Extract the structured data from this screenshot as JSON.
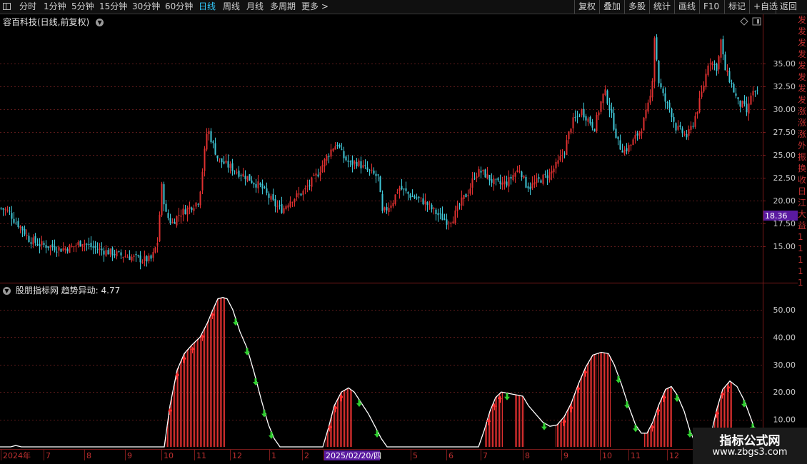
{
  "toolbar": {
    "left_items": [
      "分时",
      "1分钟",
      "5分钟",
      "15分钟",
      "30分钟",
      "60分钟",
      "日线",
      "周线",
      "月线",
      "多周期",
      "更多 >"
    ],
    "active_index": 6,
    "right_items": [
      "复权",
      "叠加",
      "多股",
      "统计",
      "画线",
      "F10",
      "标记",
      "+自选",
      "返回"
    ]
  },
  "stock_title": "容百科技(日线,前复权)",
  "indicator_title": "股朋指标网 趋势异动:",
  "indicator_value": "4.77",
  "price_axis_labels": [
    "35.00",
    "32.50",
    "30.00",
    "27.50",
    "25.00",
    "22.50",
    "20.00",
    "17.50",
    "15.00"
  ],
  "current_price": "18.36",
  "indicator_axis_labels": [
    "50.00",
    "40.00",
    "30.00",
    "20.00",
    "10.00"
  ],
  "date_axis_labels": [
    "2024年",
    "7",
    "8",
    "9",
    "10",
    "11",
    "12",
    "1",
    "2",
    "2025/02/20/四",
    "5",
    "6",
    "7",
    "8",
    "9",
    "10",
    "11",
    "12"
  ],
  "right_strip_chars": [
    "发",
    "发",
    "发",
    "发",
    "发",
    "发",
    "发",
    "发",
    "涨",
    "涨",
    "涨",
    "外",
    "振",
    "换",
    "收",
    "日",
    "江",
    "大",
    "益",
    "1",
    "1",
    "1",
    "1",
    "1"
  ],
  "watermark": {
    "title": "指标公式网",
    "url": "www.zbgs3.com"
  },
  "colors": {
    "bg": "#000000",
    "up": "#e03030",
    "down": "#40c8d8",
    "accent": "#33ccff",
    "grid": "#5a1a1a",
    "highlight": "#5a1aa0",
    "curve": "#ffffff",
    "down_arrow": "#30d030"
  },
  "chart_data": [
    {
      "type": "candlestick",
      "title": "容百科技(日线,前复权)",
      "ylim": [
        12,
        38
      ],
      "y_ticks": [
        15,
        17.5,
        20,
        22.5,
        25,
        27.5,
        30,
        32.5,
        35
      ],
      "last_price": 18.36,
      "anchors": [
        [
          0,
          19.2
        ],
        [
          12,
          18.8
        ],
        [
          20,
          17.8
        ],
        [
          30,
          17.0
        ],
        [
          40,
          15.8
        ],
        [
          55,
          15.2
        ],
        [
          70,
          15.0
        ],
        [
          85,
          14.7
        ],
        [
          100,
          14.9
        ],
        [
          115,
          15.5
        ],
        [
          125,
          15.0
        ],
        [
          140,
          14.6
        ],
        [
          155,
          14.3
        ],
        [
          170,
          14.0
        ],
        [
          185,
          13.8
        ],
        [
          200,
          13.5
        ],
        [
          212,
          13.6
        ],
        [
          220,
          15.5
        ],
        [
          226,
          21.5
        ],
        [
          232,
          18.5
        ],
        [
          240,
          17.5
        ],
        [
          250,
          18.5
        ],
        [
          260,
          19.0
        ],
        [
          270,
          19.5
        ],
        [
          278,
          20.0
        ],
        [
          284,
          24.0
        ],
        [
          290,
          28.0
        ],
        [
          296,
          26.5
        ],
        [
          305,
          24.5
        ],
        [
          315,
          24.0
        ],
        [
          325,
          23.5
        ],
        [
          335,
          23.0
        ],
        [
          345,
          22.6
        ],
        [
          355,
          22.0
        ],
        [
          365,
          21.5
        ],
        [
          375,
          20.5
        ],
        [
          385,
          19.5
        ],
        [
          395,
          19.0
        ],
        [
          405,
          20.0
        ],
        [
          415,
          20.5
        ],
        [
          425,
          21.0
        ],
        [
          435,
          22.0
        ],
        [
          445,
          23.0
        ],
        [
          455,
          24.5
        ],
        [
          465,
          25.8
        ],
        [
          472,
          26.2
        ],
        [
          480,
          24.8
        ],
        [
          490,
          24.0
        ],
        [
          500,
          24.2
        ],
        [
          510,
          23.5
        ],
        [
          520,
          23.0
        ],
        [
          530,
          22.5
        ],
        [
          534,
          18.5
        ],
        [
          542,
          19.2
        ],
        [
          550,
          20.0
        ],
        [
          558,
          21.5
        ],
        [
          566,
          21.0
        ],
        [
          575,
          20.5
        ],
        [
          585,
          20.2
        ],
        [
          595,
          19.8
        ],
        [
          605,
          19.0
        ],
        [
          615,
          18.3
        ],
        [
          625,
          17.8
        ],
        [
          633,
          18.0
        ],
        [
          640,
          19.0
        ],
        [
          648,
          20.2
        ],
        [
          656,
          21.0
        ],
        [
          664,
          22.8
        ],
        [
          672,
          23.2
        ],
        [
          680,
          22.8
        ],
        [
          690,
          22.0
        ],
        [
          700,
          21.8
        ],
        [
          710,
          22.0
        ],
        [
          720,
          23.0
        ],
        [
          728,
          23.5
        ],
        [
          735,
          21.8
        ],
        [
          742,
          21.5
        ],
        [
          750,
          22.0
        ],
        [
          760,
          22.5
        ],
        [
          770,
          23.0
        ],
        [
          780,
          24.0
        ],
        [
          790,
          25.5
        ],
        [
          800,
          28.5
        ],
        [
          808,
          29.2
        ],
        [
          814,
          29.8
        ],
        [
          822,
          29.0
        ],
        [
          832,
          28.0
        ],
        [
          840,
          30.5
        ],
        [
          846,
          32.0
        ],
        [
          852,
          30.5
        ],
        [
          858,
          28.5
        ],
        [
          866,
          26.0
        ],
        [
          874,
          25.5
        ],
        [
          882,
          26.0
        ],
        [
          890,
          27.0
        ],
        [
          898,
          28.0
        ],
        [
          906,
          30.0
        ],
        [
          912,
          32.0
        ],
        [
          916,
          38.0
        ],
        [
          922,
          33.0
        ],
        [
          930,
          31.0
        ],
        [
          938,
          30.0
        ],
        [
          946,
          28.0
        ],
        [
          954,
          27.5
        ],
        [
          962,
          27.0
        ],
        [
          970,
          28.5
        ],
        [
          978,
          30.5
        ],
        [
          986,
          33.0
        ],
        [
          992,
          35.5
        ],
        [
          998,
          35.0
        ],
        [
          1004,
          34.5
        ],
        [
          1009,
          37.5
        ],
        [
          1014,
          34.5
        ],
        [
          1020,
          33.5
        ],
        [
          1027,
          32.0
        ],
        [
          1034,
          30.5
        ],
        [
          1040,
          30.5
        ],
        [
          1046,
          29.5
        ],
        [
          1052,
          32.0
        ],
        [
          1058,
          31.5
        ],
        [
          1062,
          31.8
        ]
      ],
      "vol_seed": 7
    },
    {
      "type": "area",
      "title": "股朋指标网 趋势异动",
      "ylim": [
        0,
        55
      ],
      "y_ticks": [
        10,
        20,
        30,
        40,
        50
      ],
      "curve": [
        [
          0,
          0
        ],
        [
          15,
          0
        ],
        [
          22,
          0.5
        ],
        [
          30,
          0
        ],
        [
          200,
          0
        ],
        [
          230,
          0
        ],
        [
          238,
          15
        ],
        [
          248,
          28
        ],
        [
          258,
          34
        ],
        [
          268,
          37
        ],
        [
          280,
          40
        ],
        [
          290,
          45
        ],
        [
          298,
          50
        ],
        [
          305,
          54
        ],
        [
          312,
          54.5
        ],
        [
          318,
          54
        ],
        [
          326,
          50
        ],
        [
          336,
          42
        ],
        [
          346,
          36
        ],
        [
          356,
          27
        ],
        [
          366,
          17
        ],
        [
          376,
          8
        ],
        [
          384,
          3
        ],
        [
          392,
          0
        ],
        [
          452,
          0
        ],
        [
          460,
          7
        ],
        [
          468,
          15
        ],
        [
          478,
          20
        ],
        [
          488,
          21.5
        ],
        [
          496,
          20
        ],
        [
          506,
          16
        ],
        [
          516,
          12
        ],
        [
          526,
          7
        ],
        [
          534,
          3
        ],
        [
          542,
          0
        ],
        [
          670,
          0
        ],
        [
          678,
          6
        ],
        [
          686,
          13
        ],
        [
          694,
          18
        ],
        [
          702,
          20
        ],
        [
          712,
          19.5
        ],
        [
          722,
          19
        ],
        [
          732,
          18.5
        ],
        [
          740,
          15
        ],
        [
          750,
          12
        ],
        [
          760,
          9
        ],
        [
          770,
          7.5
        ],
        [
          780,
          8
        ],
        [
          790,
          11
        ],
        [
          800,
          16
        ],
        [
          810,
          23
        ],
        [
          820,
          29
        ],
        [
          830,
          33.5
        ],
        [
          842,
          34.5
        ],
        [
          852,
          34
        ],
        [
          860,
          30
        ],
        [
          870,
          23
        ],
        [
          880,
          15
        ],
        [
          890,
          8
        ],
        [
          898,
          5
        ],
        [
          906,
          5
        ],
        [
          914,
          9
        ],
        [
          922,
          15
        ],
        [
          932,
          21
        ],
        [
          940,
          22
        ],
        [
          948,
          19
        ],
        [
          958,
          13
        ],
        [
          966,
          6
        ],
        [
          974,
          1
        ],
        [
          986,
          1
        ],
        [
          996,
          5
        ],
        [
          1004,
          14
        ],
        [
          1012,
          21
        ],
        [
          1022,
          24
        ],
        [
          1032,
          22
        ],
        [
          1042,
          17
        ],
        [
          1052,
          10
        ],
        [
          1060,
          4
        ],
        [
          1066,
          1
        ]
      ],
      "filled_ranges": [
        [
          232,
          314
        ],
        [
          456,
          492
        ],
        [
          679,
          704
        ],
        [
          721,
          734
        ],
        [
          778,
          834
        ],
        [
          838,
          854
        ],
        [
          902,
          940
        ],
        [
          998,
          1024
        ]
      ]
    }
  ]
}
